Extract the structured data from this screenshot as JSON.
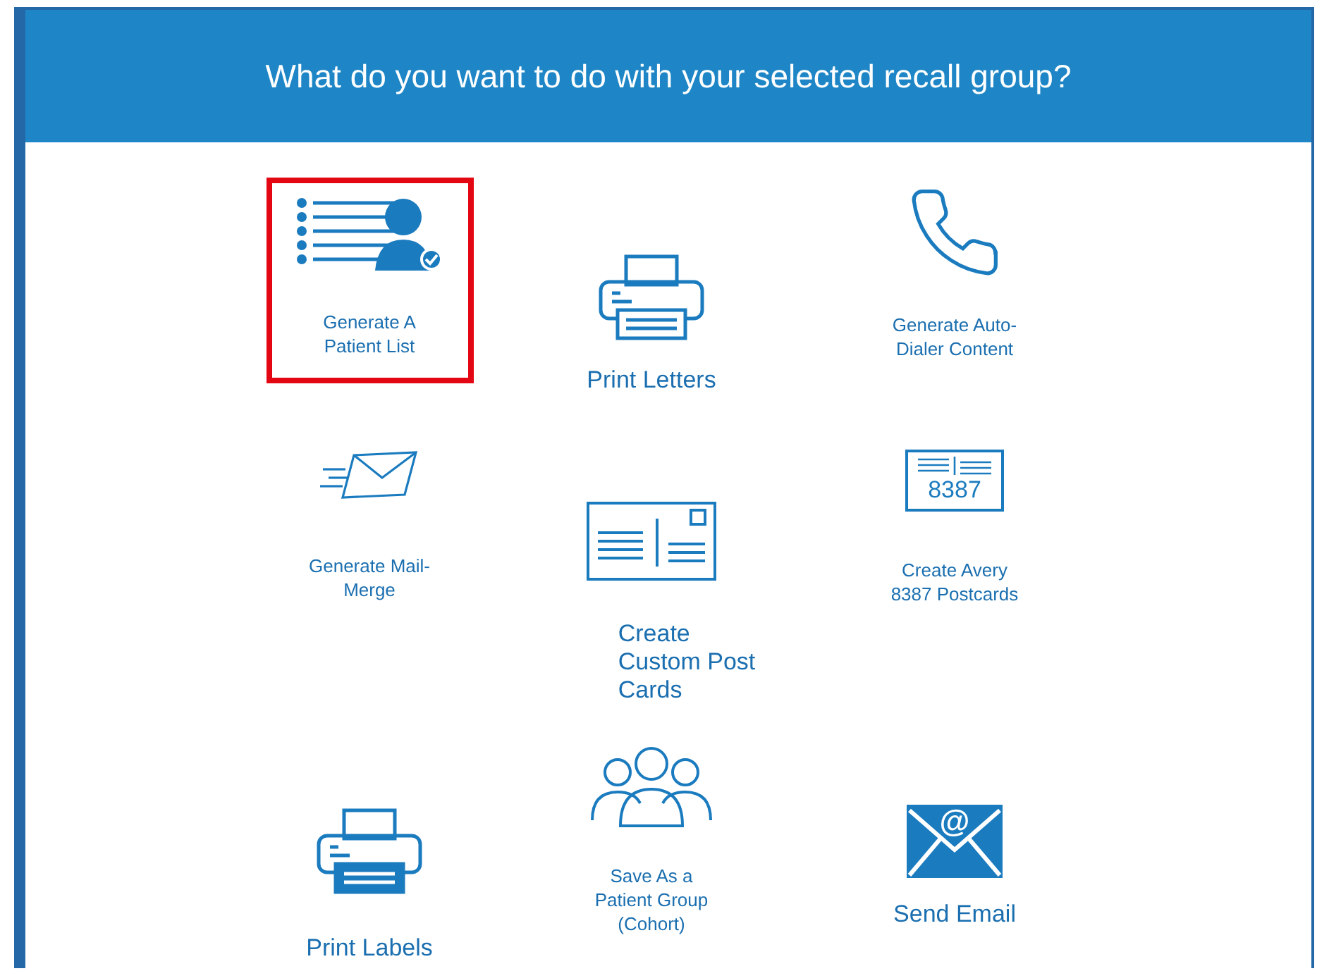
{
  "header": {
    "title": "What do you want to do with your selected recall group?"
  },
  "columns": [
    {
      "options": [
        {
          "kind": "patient-list",
          "label": "Generate A\nPatient List",
          "selected": true
        },
        {
          "kind": "mail-merge",
          "label": "Generate Mail-\nMerge",
          "selected": false
        },
        {
          "kind": "print-labels",
          "label": "Print Labels",
          "selected": false
        }
      ]
    },
    {
      "options": [
        {
          "kind": "print-letters",
          "label": "Print Letters",
          "selected": false
        },
        {
          "kind": "custom-postcards",
          "label": "Create\nCustom Post\nCards",
          "selected": false
        },
        {
          "kind": "cohort",
          "label": "Save As a\nPatient Group\n(Cohort)",
          "selected": false
        }
      ]
    },
    {
      "options": [
        {
          "kind": "auto-dialer",
          "label": "Generate Auto-\nDialer Content",
          "selected": false
        },
        {
          "kind": "avery",
          "label": "Create Avery\n8387 Postcards",
          "icon_text": "8387",
          "selected": false
        },
        {
          "kind": "email",
          "label": "Send Email",
          "icon_text": "@",
          "selected": false
        }
      ]
    }
  ]
}
